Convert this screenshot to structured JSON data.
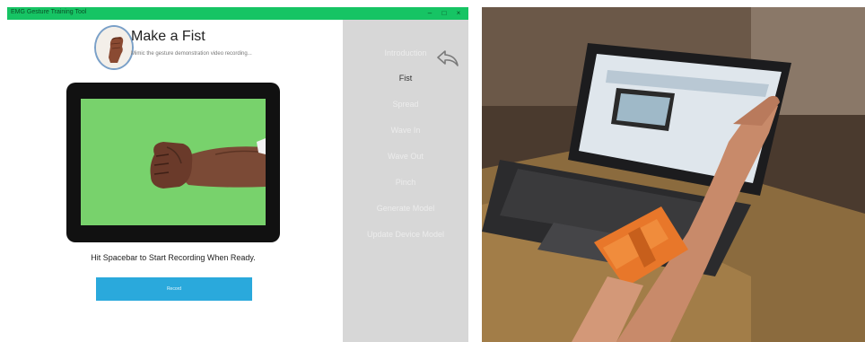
{
  "window": {
    "title": "EMG Gesture Training Tool",
    "minimize": "–",
    "maximize": "□",
    "close": "×"
  },
  "step": {
    "title": "Make a Fist",
    "subtitle": "Mimic the gesture demonstration video recording..."
  },
  "instruction": "Hit Spacebar to Start Recording When Ready.",
  "record_button": "Record",
  "sidebar": {
    "items": [
      {
        "label": "Introduction",
        "active": false
      },
      {
        "label": "Fist",
        "active": true
      },
      {
        "label": "Spread",
        "active": false
      },
      {
        "label": "Wave In",
        "active": false
      },
      {
        "label": "Wave Out",
        "active": false
      },
      {
        "label": "Pinch",
        "active": false
      },
      {
        "label": "Generate Model",
        "active": false
      },
      {
        "label": "Update Device Model",
        "active": false
      }
    ]
  },
  "icons": {
    "back": "back-arrow-icon",
    "avatar": "fist-hand-icon"
  },
  "colors": {
    "titlebar": "#16c464",
    "button": "#2aa9dc",
    "sidebar": "#d7d7d7",
    "video_background": "#78d26c"
  }
}
